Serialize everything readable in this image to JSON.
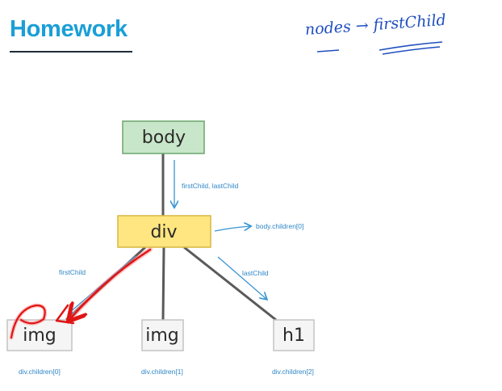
{
  "header": {
    "title": "Homework",
    "note": "nodes → firstChild"
  },
  "nodes": {
    "body": "body",
    "div": "div",
    "img_1": "img",
    "img_2": "img",
    "h1": "h1"
  },
  "edge_labels": {
    "body_to_div": "firstChild, lastChild",
    "div_right": "body.children[0]",
    "div_to_img_1": "firstChild",
    "div_to_h1": "lastChild"
  },
  "child_labels": {
    "img_1": "div.children[0]",
    "img_2": "div.children[1]",
    "h1": "div.children[2]"
  },
  "colors": {
    "title": "#1a9fd6",
    "body_fill": "#c8e6c9",
    "body_stroke": "#6aa56e",
    "div_fill": "#ffe680",
    "div_stroke": "#d9b740",
    "leaf_fill": "#f5f5f5",
    "leaf_stroke": "#c4c4c4",
    "line": "#5a5a5a",
    "blue_arrow": "#3b95d3",
    "red_annotation": "#e01515",
    "handwriting": "#1f4fbf"
  }
}
